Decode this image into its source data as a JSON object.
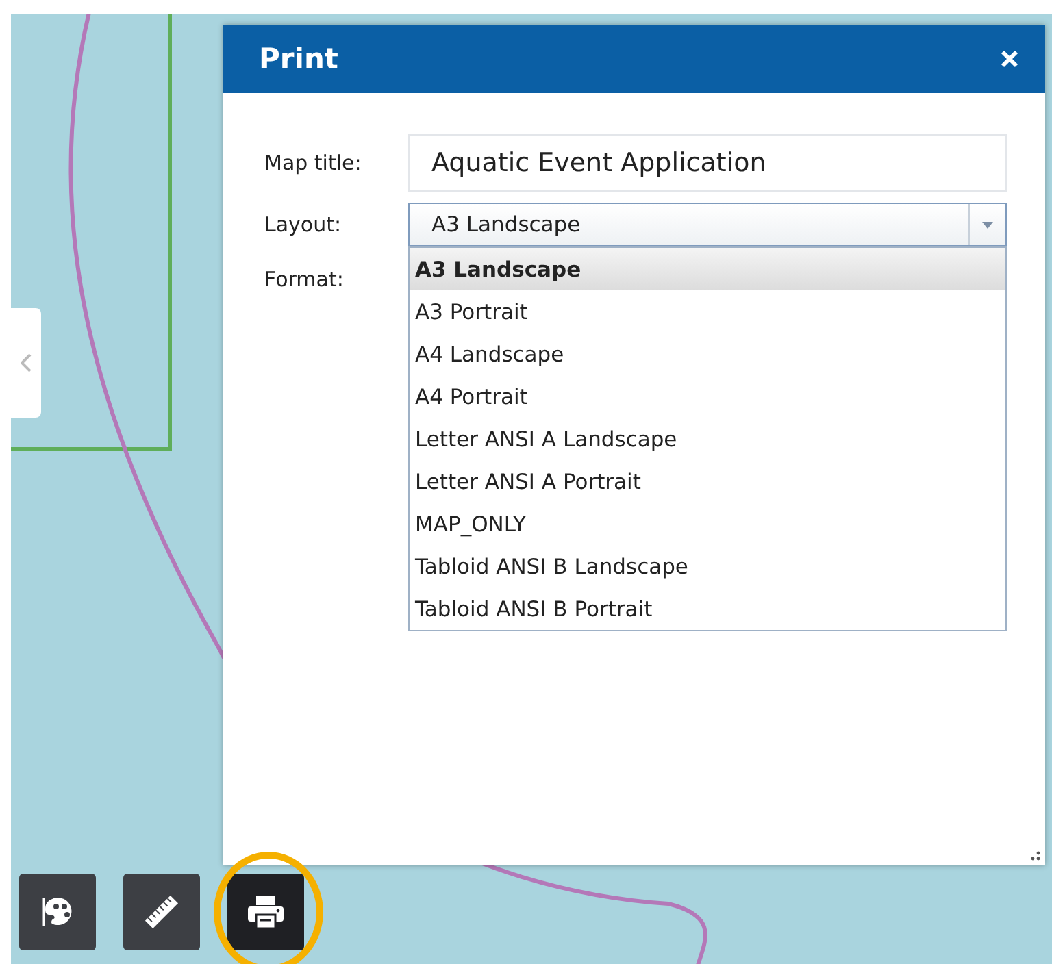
{
  "dialog": {
    "title": "Print",
    "fields": [
      {
        "label": "Map title:",
        "kind": "text",
        "value": "Aquatic Event Application"
      },
      {
        "label": "Layout:",
        "kind": "select",
        "value": "A3 Landscape",
        "expanded": true,
        "options": [
          {
            "label": "A3 Landscape",
            "selected": true
          },
          {
            "label": "A3 Portrait",
            "selected": false
          },
          {
            "label": "A4 Landscape",
            "selected": false
          },
          {
            "label": "A4 Portrait",
            "selected": false
          },
          {
            "label": "Letter ANSI A Landscape",
            "selected": false
          },
          {
            "label": "Letter ANSI A Portrait",
            "selected": false
          },
          {
            "label": "MAP_ONLY",
            "selected": false
          },
          {
            "label": "Tabloid ANSI B Landscape",
            "selected": false
          },
          {
            "label": "Tabloid ANSI B Portrait",
            "selected": false
          }
        ]
      },
      {
        "label": "Format:",
        "kind": "select"
      }
    ]
  },
  "toolbar": [
    {
      "kind": "palette",
      "selected": false,
      "highlighted": false
    },
    {
      "kind": "ruler",
      "selected": false,
      "highlighted": false
    },
    {
      "kind": "printer",
      "selected": true,
      "highlighted": true
    }
  ]
}
